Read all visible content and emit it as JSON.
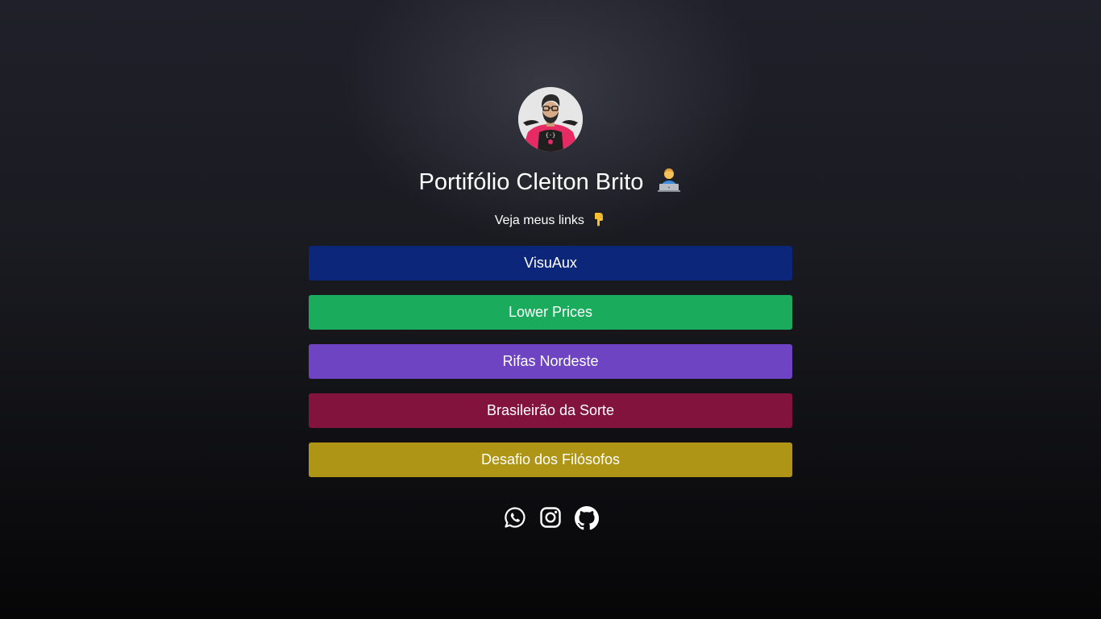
{
  "profile": {
    "title": "Portifólio Cleiton Brito",
    "title_emoji": "technologist-emoji",
    "subtitle": "Veja meus links",
    "subtitle_emoji": "pointing-down-emoji",
    "avatar_icon": "developer-avatar-illustration"
  },
  "links": [
    {
      "label": "VisuAux",
      "color": "#0c267a"
    },
    {
      "label": "Lower Prices",
      "color": "#1aab5c"
    },
    {
      "label": "Rifas Nordeste",
      "color": "#6e44c2"
    },
    {
      "label": "Brasileirão da Sorte",
      "color": "#82133d"
    },
    {
      "label": "Desafio dos Filósofos",
      "color": "#ae9516"
    }
  ],
  "socials": [
    {
      "icon": "whatsapp-icon"
    },
    {
      "icon": "instagram-icon"
    },
    {
      "icon": "github-icon"
    }
  ]
}
